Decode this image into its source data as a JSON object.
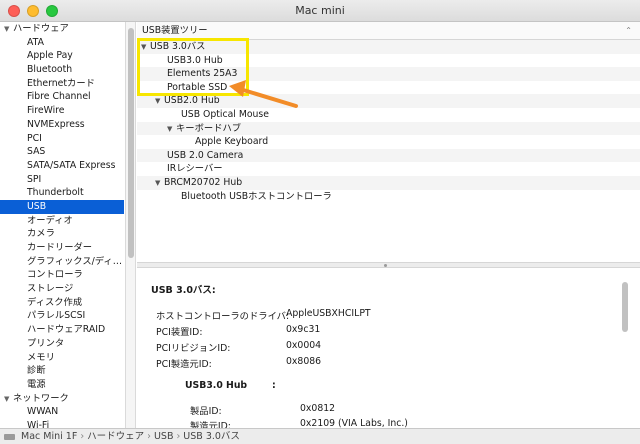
{
  "window": {
    "title": "Mac mini",
    "traffic_lights": {
      "close": "#fe5f57",
      "minimize": "#febc2e",
      "zoom": "#28c840"
    }
  },
  "sidebar": {
    "groups": [
      {
        "label": "ハードウェア",
        "items": [
          "ATA",
          "Apple Pay",
          "Bluetooth",
          "Ethernetカード",
          "Fibre Channel",
          "FireWire",
          "NVMExpress",
          "PCI",
          "SAS",
          "SATA/SATA Express",
          "SPI",
          "Thunderbolt",
          "USB",
          "オーディオ",
          "カメラ",
          "カードリーダー",
          "グラフィックス/ディ…",
          "コントローラ",
          "ストレージ",
          "ディスク作成",
          "パラレルSCSI",
          "ハードウェアRAID",
          "プリンタ",
          "メモリ",
          "診断",
          "電源"
        ],
        "selected": "USB"
      },
      {
        "label": "ネットワーク",
        "items": [
          "WWAN",
          "Wi-Fi"
        ]
      }
    ]
  },
  "tree": {
    "header": "USB装置ツリー",
    "rows": [
      {
        "label": "USB 3.0バス",
        "expanded": true
      },
      {
        "label": "USB3.0 Hub"
      },
      {
        "label": "Elements 25A3"
      },
      {
        "label": "Portable SSD"
      },
      {
        "label": "USB2.0 Hub",
        "expanded": true
      },
      {
        "label": "USB Optical Mouse"
      },
      {
        "label": "キーボードハブ",
        "expanded": true
      },
      {
        "label": "Apple Keyboard"
      },
      {
        "label": "USB 2.0 Camera"
      },
      {
        "label": "IRレシーバー"
      },
      {
        "label": "BRCM20702 Hub",
        "expanded": true
      },
      {
        "label": "Bluetooth USBホストコントローラ"
      }
    ]
  },
  "detail": {
    "title": "USB 3.0バス:",
    "properties": [
      {
        "label": "ホストコントローラのドライバ:",
        "value": "AppleUSBXHCILPT"
      },
      {
        "label": "PCI装置ID:",
        "value": "0x9c31"
      },
      {
        "label": "PCIリビジョンID:",
        "value": "0x0004"
      },
      {
        "label": "PCI製造元ID:",
        "value": "0x8086"
      }
    ],
    "sub_title": "USB3.0 Hub",
    "sub_colon": ":",
    "sub_properties": [
      {
        "label": "製品ID:",
        "value": "0x0812"
      },
      {
        "label": "製造元ID:",
        "value": "0x2109  (VIA Labs, Inc.)"
      }
    ]
  },
  "statusbar": {
    "crumbs": [
      "Mac Mini 1F",
      "ハードウェア",
      "USB",
      "USB 3.0バス"
    ]
  },
  "annotation": {
    "highlight_color": "#f7e600",
    "arrow_color": "#f28c28"
  }
}
